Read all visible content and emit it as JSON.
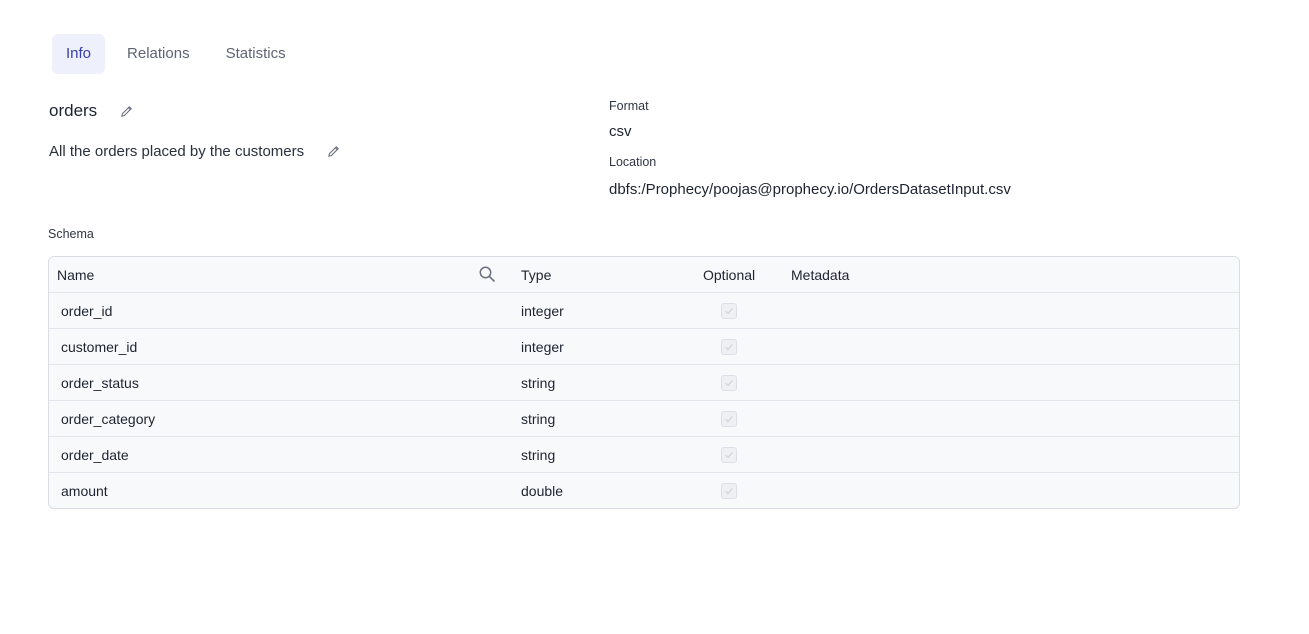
{
  "tabs": [
    {
      "label": "Info",
      "active": true
    },
    {
      "label": "Relations",
      "active": false
    },
    {
      "label": "Statistics",
      "active": false
    }
  ],
  "dataset": {
    "name": "orders",
    "description": "All the orders placed by the customers"
  },
  "details": {
    "format_label": "Format",
    "format_value": "csv",
    "location_label": "Location",
    "location_value": "dbfs:/Prophecy/poojas@prophecy.io/OrdersDatasetInput.csv"
  },
  "schema": {
    "label": "Schema",
    "columns": [
      "Name",
      "Type",
      "Optional",
      "Metadata"
    ],
    "rows": [
      {
        "name": "order_id",
        "type": "integer",
        "optional": false
      },
      {
        "name": "customer_id",
        "type": "integer",
        "optional": false
      },
      {
        "name": "order_status",
        "type": "string",
        "optional": false
      },
      {
        "name": "order_category",
        "type": "string",
        "optional": false
      },
      {
        "name": "order_date",
        "type": "string",
        "optional": false
      },
      {
        "name": "amount",
        "type": "double",
        "optional": false
      }
    ]
  },
  "colors": {
    "active_tab_bg": "#eef0fb",
    "active_tab_text": "#3b3fa8",
    "table_border": "#d9dce3"
  },
  "icons": {
    "edit": "pencil-icon",
    "search": "search-icon",
    "check": "check-icon"
  }
}
